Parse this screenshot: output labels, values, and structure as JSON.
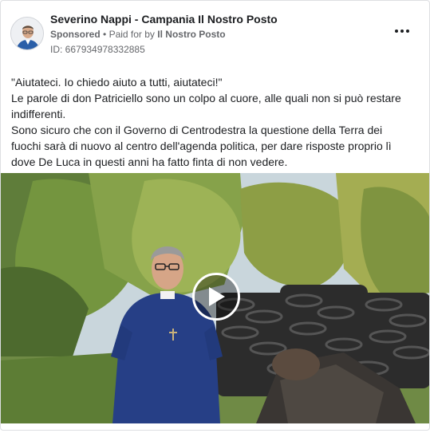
{
  "post": {
    "page_name": "Severino Nappi - Campania Il Nostro Posto",
    "sponsored_label": "Sponsored",
    "separator": "•",
    "paid_for_label": "Paid for by",
    "paid_for_by": "Il Nostro Posto",
    "ad_id": "ID: 667934978332885",
    "paragraphs": [
      "\"Aiutateci. Io chiedo aiuto a tutti, aiutateci!\"",
      "Le parole di don Patriciello sono un colpo al cuore, alle quali non si può restare indifferenti.",
      "Sono sicuro che con il Governo di Centrodestra la questione della Terra dei fuochi sarà di nuovo al centro dell'agenda politica, per dare risposte proprio lì dove De Luca in questi anni ha fatto finta di non vedere."
    ]
  },
  "icons": {
    "more": "more-options-icon",
    "play": "play-icon",
    "avatar": "profile-avatar"
  },
  "colors": {
    "text": "#1c1e21",
    "secondary_text": "#65676b",
    "border": "#dddfe2"
  }
}
